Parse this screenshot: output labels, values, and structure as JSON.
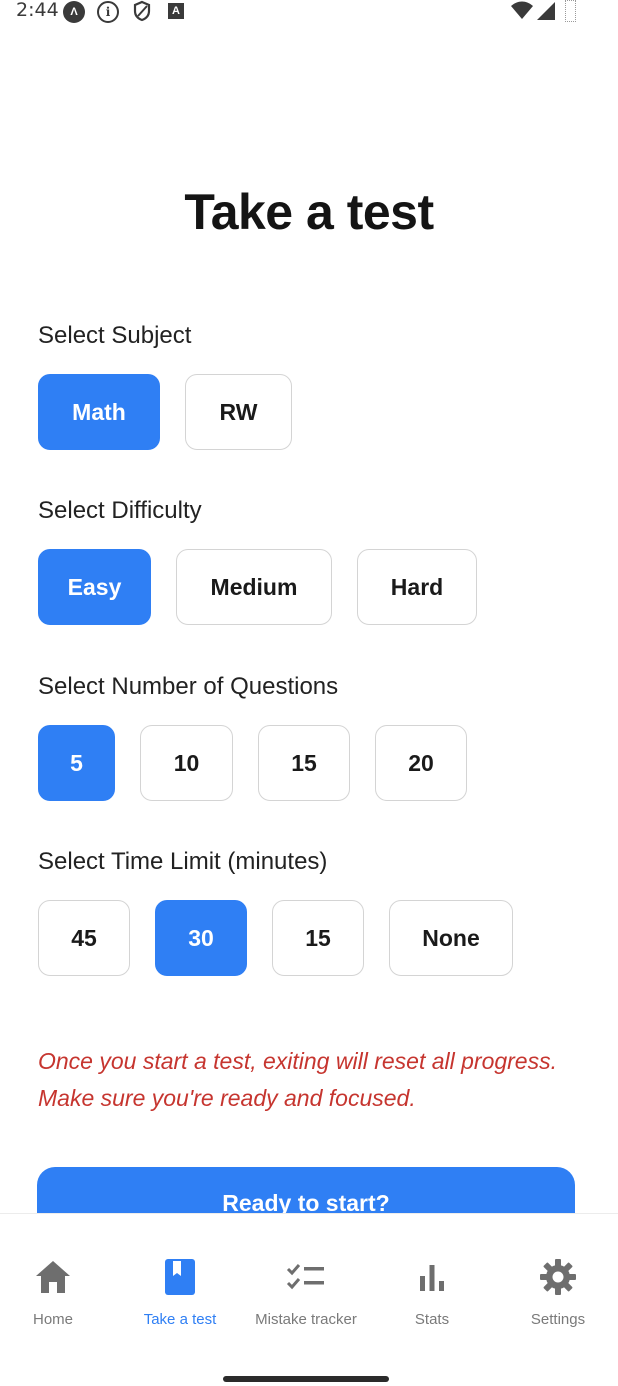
{
  "status_bar": {
    "time": "2:44",
    "icons": [
      "a-app-icon",
      "info-icon",
      "shield-icon",
      "font-icon",
      "wifi-icon",
      "signal-icon",
      "battery-icon"
    ]
  },
  "page": {
    "title": "Take a test"
  },
  "subject": {
    "label": "Select Subject",
    "options": [
      "Math",
      "RW"
    ],
    "selected": "Math"
  },
  "difficulty": {
    "label": "Select Difficulty",
    "options": [
      "Easy",
      "Medium",
      "Hard"
    ],
    "selected": "Easy"
  },
  "questions": {
    "label": "Select Number of Questions",
    "options": [
      "5",
      "10",
      "15",
      "20"
    ],
    "selected": "5"
  },
  "time_limit": {
    "label": "Select Time Limit (minutes)",
    "options": [
      "45",
      "30",
      "15",
      "None"
    ],
    "selected": "30"
  },
  "warning": {
    "text": "Once you start a test, exiting will reset all progress. Make sure you're ready and focused."
  },
  "start_button": {
    "label": "Ready to start?"
  },
  "nav": {
    "items": [
      {
        "label": "Home",
        "icon": "home-icon"
      },
      {
        "label": "Take a test",
        "icon": "book-icon"
      },
      {
        "label": "Mistake tracker",
        "icon": "checklist-icon"
      },
      {
        "label": "Stats",
        "icon": "bar-chart-icon"
      },
      {
        "label": "Settings",
        "icon": "gear-icon"
      }
    ],
    "active": "Take a test"
  },
  "colors": {
    "accent": "#2f7ff4",
    "warning": "#c6352f",
    "inactive": "#7a7a7a"
  }
}
